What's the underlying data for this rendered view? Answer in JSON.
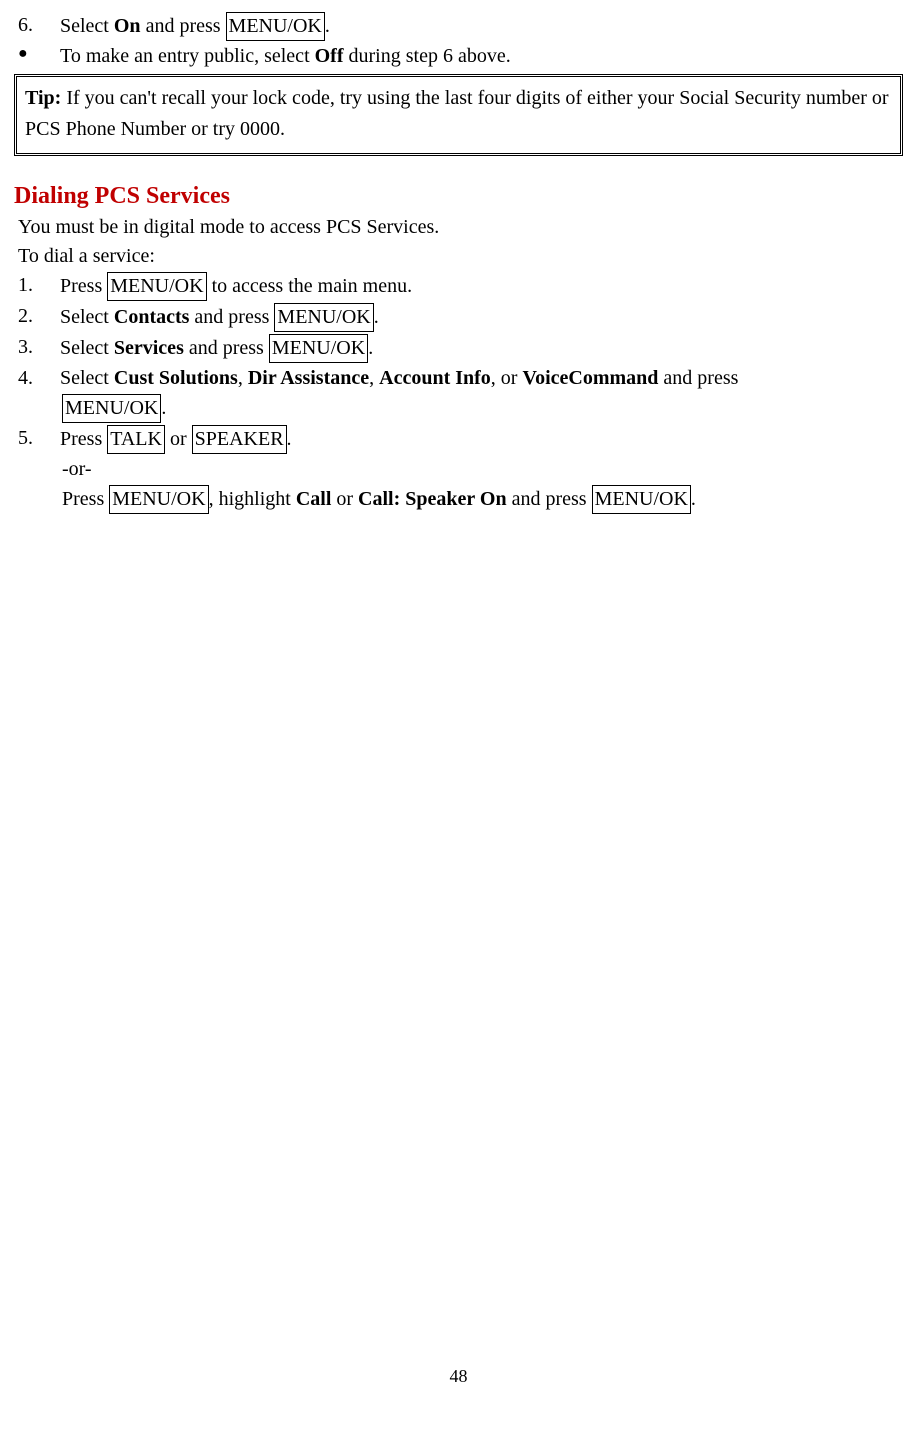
{
  "top": {
    "item6": {
      "marker": "6.",
      "pre": "Select ",
      "on": "On",
      "mid": " and press ",
      "key": "MENU/OK",
      "post": "."
    },
    "bullet": {
      "pre": "To make an entry public, select ",
      "off": "Off",
      "post": " during step 6 above."
    }
  },
  "tip": {
    "label": "Tip:",
    "text": " If you can't recall your lock code, try using the last four digits of either your Social Security number or PCS Phone Number or try 0000."
  },
  "section": {
    "heading": "Dialing PCS Services",
    "intro1": "You must be in digital mode to access PCS Services.",
    "intro2": "To dial a service:",
    "step1": {
      "marker": "1.",
      "pre": "Press ",
      "key": "MENU/OK",
      "post": " to access the main menu."
    },
    "step2": {
      "marker": "2.",
      "pre": "Select ",
      "b": "Contacts",
      "mid": " and press ",
      "key": "MENU/OK",
      "post": "."
    },
    "step3": {
      "marker": "3.",
      "pre": "Select ",
      "b": "Services",
      "mid": " and press ",
      "key": "MENU/OK",
      "post": "."
    },
    "step4": {
      "marker": "4.",
      "pre": "Select ",
      "b1": "Cust Solutions",
      "c1": ", ",
      "b2": "Dir Assistance",
      "c2": ", ",
      "b3": "Account Info",
      "c3": ", or ",
      "b4": "VoiceCommand",
      "post": " and press",
      "key_line": "MENU/OK",
      "post2": "."
    },
    "step5": {
      "marker": "5.",
      "pre": "Press ",
      "key1": "TALK",
      "mid": " or ",
      "key2": "SPEAKER",
      "post": ".",
      "or": "-or-",
      "line3_pre": "Press ",
      "line3_key1": "MENU/OK",
      "line3_mid1": ", highlight ",
      "line3_b1": "Call",
      "line3_mid2": " or ",
      "line3_b2": "Call: Speaker On",
      "line3_mid3": " and press ",
      "line3_key2": "MENU/OK",
      "line3_post": "."
    }
  },
  "page": "48"
}
